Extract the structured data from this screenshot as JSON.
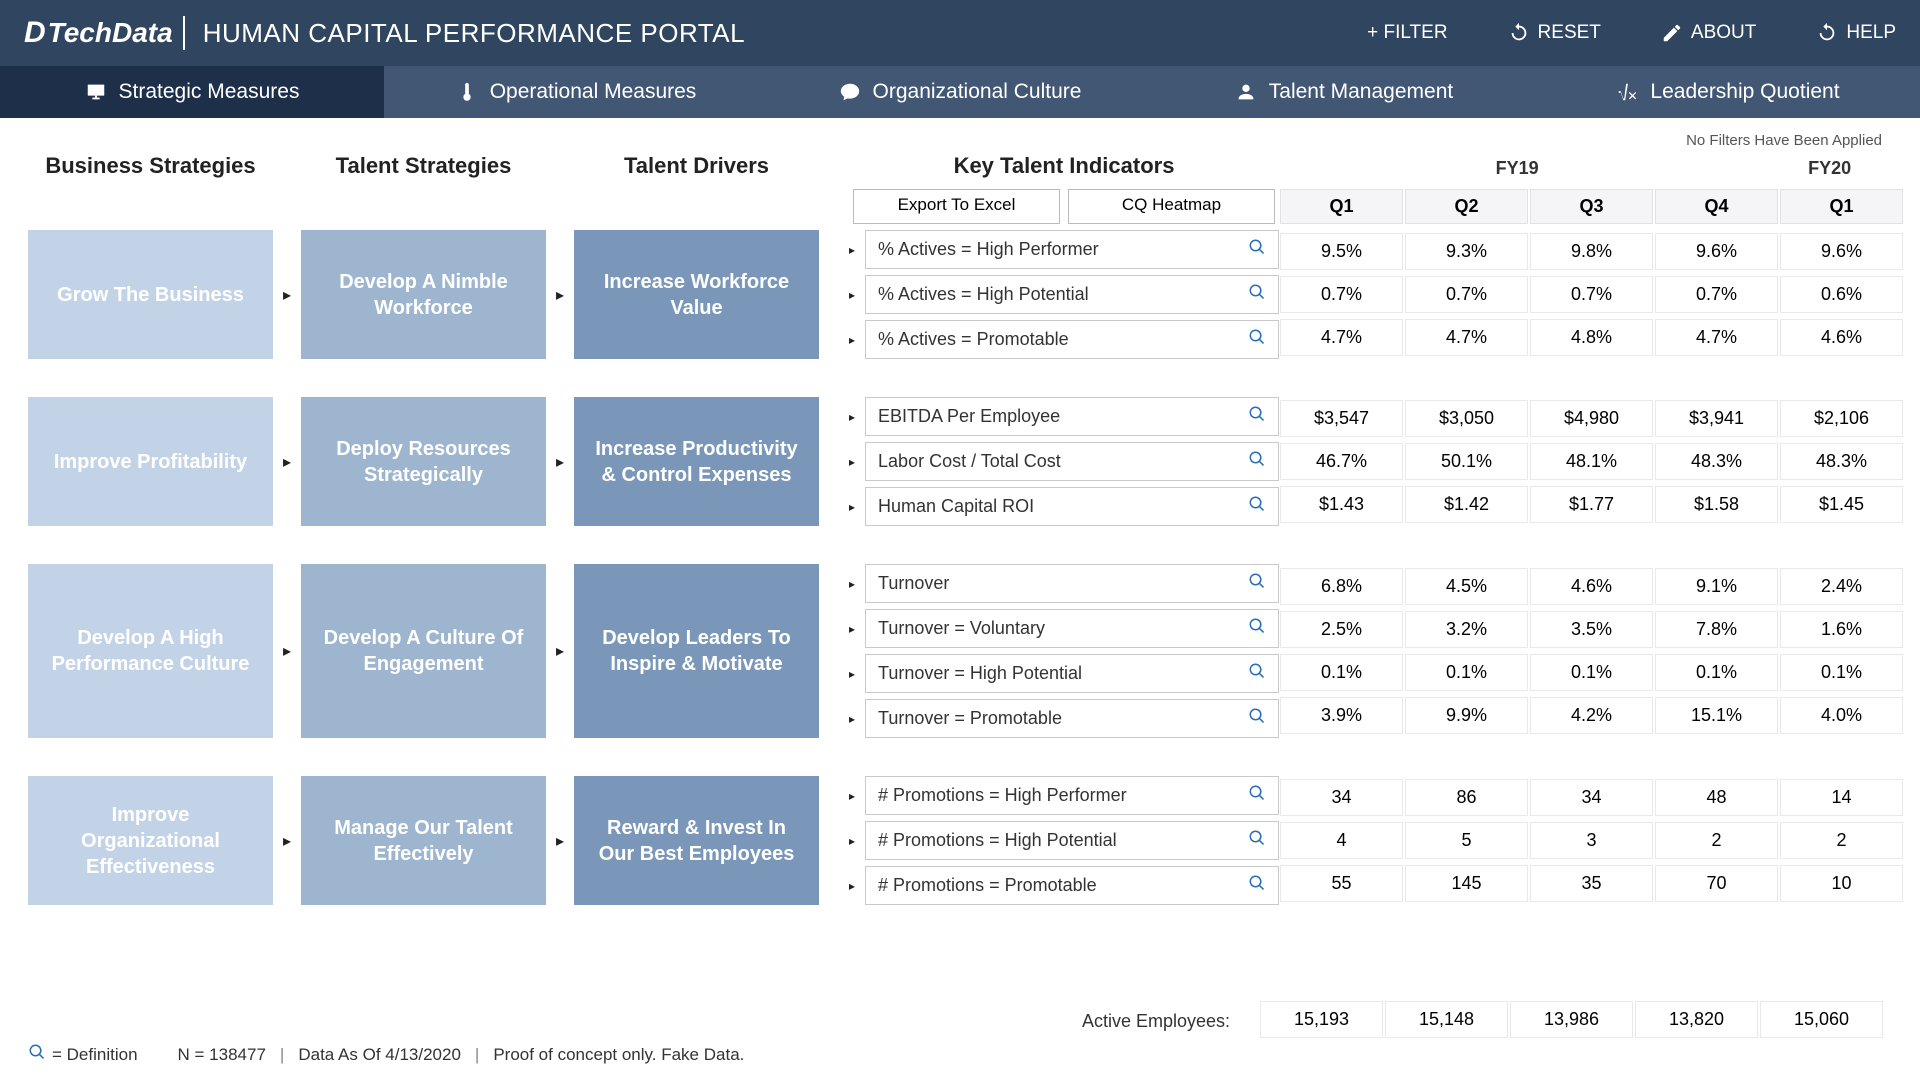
{
  "header": {
    "logo_text": "TechData",
    "app_title": "HUMAN CAPITAL PERFORMANCE PORTAL",
    "actions": {
      "filter": "+ FILTER",
      "reset": "RESET",
      "about": "ABOUT",
      "help": "HELP"
    }
  },
  "tabs": {
    "strategic": "Strategic Measures",
    "operational": "Operational Measures",
    "culture": "Organizational Culture",
    "talent": "Talent Management",
    "leadership": "Leadership Quotient"
  },
  "no_filter_msg": "No Filters Have Been Applied",
  "columns": {
    "biz": "Business Strategies",
    "talent": "Talent Strategies",
    "drivers": "Talent Drivers",
    "kti": "Key Talent Indicators"
  },
  "years": {
    "fy19": "FY19",
    "fy20": "FY20"
  },
  "quarters": [
    "Q1",
    "Q2",
    "Q3",
    "Q4",
    "Q1"
  ],
  "buttons": {
    "export": "Export To Excel",
    "heatmap": "CQ Heatmap"
  },
  "groups": [
    {
      "c1": "Grow The Business",
      "c2": "Develop A Nimble Workforce",
      "c3": "Increase Workforce Value",
      "kti": [
        {
          "label": "% Actives = High Performer",
          "vals": [
            "9.5%",
            "9.3%",
            "9.8%",
            "9.6%",
            "9.6%"
          ]
        },
        {
          "label": "% Actives = High Potential",
          "vals": [
            "0.7%",
            "0.7%",
            "0.7%",
            "0.7%",
            "0.6%"
          ]
        },
        {
          "label": "% Actives = Promotable",
          "vals": [
            "4.7%",
            "4.7%",
            "4.8%",
            "4.7%",
            "4.6%"
          ]
        }
      ]
    },
    {
      "c1": "Improve Profitability",
      "c2": "Deploy Resources Strategically",
      "c3": "Increase Productivity & Control Expenses",
      "kti": [
        {
          "label": "EBITDA Per Employee",
          "vals": [
            "$3,547",
            "$3,050",
            "$4,980",
            "$3,941",
            "$2,106"
          ]
        },
        {
          "label": "Labor Cost / Total Cost",
          "vals": [
            "46.7%",
            "50.1%",
            "48.1%",
            "48.3%",
            "48.3%"
          ]
        },
        {
          "label": "Human Capital ROI",
          "vals": [
            "$1.43",
            "$1.42",
            "$1.77",
            "$1.58",
            "$1.45"
          ]
        }
      ]
    },
    {
      "c1": "Develop A High Performance Culture",
      "c2": "Develop A Culture Of Engagement",
      "c3": "Develop Leaders To Inspire & Motivate",
      "kti": [
        {
          "label": "Turnover",
          "vals": [
            "6.8%",
            "4.5%",
            "4.6%",
            "9.1%",
            "2.4%"
          ]
        },
        {
          "label": "Turnover = Voluntary",
          "vals": [
            "2.5%",
            "3.2%",
            "3.5%",
            "7.8%",
            "1.6%"
          ]
        },
        {
          "label": "Turnover = High Potential",
          "vals": [
            "0.1%",
            "0.1%",
            "0.1%",
            "0.1%",
            "0.1%"
          ]
        },
        {
          "label": "Turnover = Promotable",
          "vals": [
            "3.9%",
            "9.9%",
            "4.2%",
            "15.1%",
            "4.0%"
          ]
        }
      ]
    },
    {
      "c1": "Improve Organizational Effectiveness",
      "c2": "Manage Our Talent Effectively",
      "c3": "Reward & Invest In Our Best Employees",
      "kti": [
        {
          "label": "# Promotions = High Performer",
          "vals": [
            "34",
            "86",
            "34",
            "48",
            "14"
          ]
        },
        {
          "label": "# Promotions = High Potential",
          "vals": [
            "4",
            "5",
            "3",
            "2",
            "2"
          ]
        },
        {
          "label": "# Promotions = Promotable",
          "vals": [
            "55",
            "145",
            "35",
            "70",
            "10"
          ]
        }
      ]
    }
  ],
  "active_emp": {
    "label": "Active Employees:",
    "vals": [
      "15,193",
      "15,148",
      "13,986",
      "13,820",
      "15,060"
    ]
  },
  "footer": {
    "definition": "= Definition",
    "n": "N = 138477",
    "asof": "Data As Of 4/13/2020",
    "poc": "Proof of concept only.  Fake Data."
  }
}
